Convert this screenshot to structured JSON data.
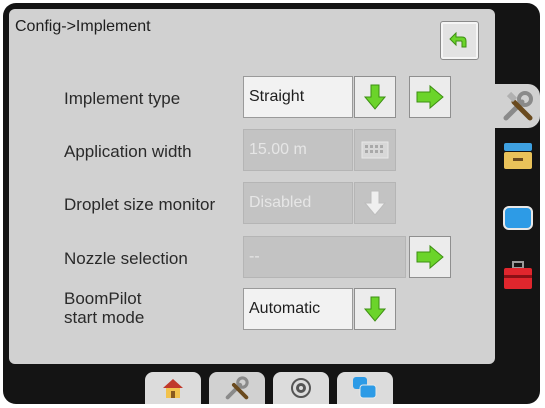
{
  "header": {
    "title": "Config->Implement"
  },
  "rows": [
    {
      "label": "Implement type",
      "value": "Straight",
      "state": "active"
    },
    {
      "label": "Application width",
      "value": "15.00 m",
      "state": "disabled"
    },
    {
      "label": "Droplet size monitor",
      "value": "Disabled",
      "state": "disabled"
    },
    {
      "label": "Nozzle selection",
      "value": "--",
      "state": "disabled"
    },
    {
      "label_line1": "BoomPilot",
      "label_line2": "start mode",
      "value": "Automatic",
      "state": "active"
    }
  ],
  "side_tabs": [
    "tools-icon",
    "drawer-icon",
    "screen-icon",
    "toolbox-icon"
  ],
  "bottom_tabs": [
    "home-icon",
    "tools-icon",
    "gps-icon",
    "layers-icon"
  ],
  "colors": {
    "green_arrow": "#6bd42a",
    "panel": "#d1d1d1",
    "frame": "#141414"
  }
}
